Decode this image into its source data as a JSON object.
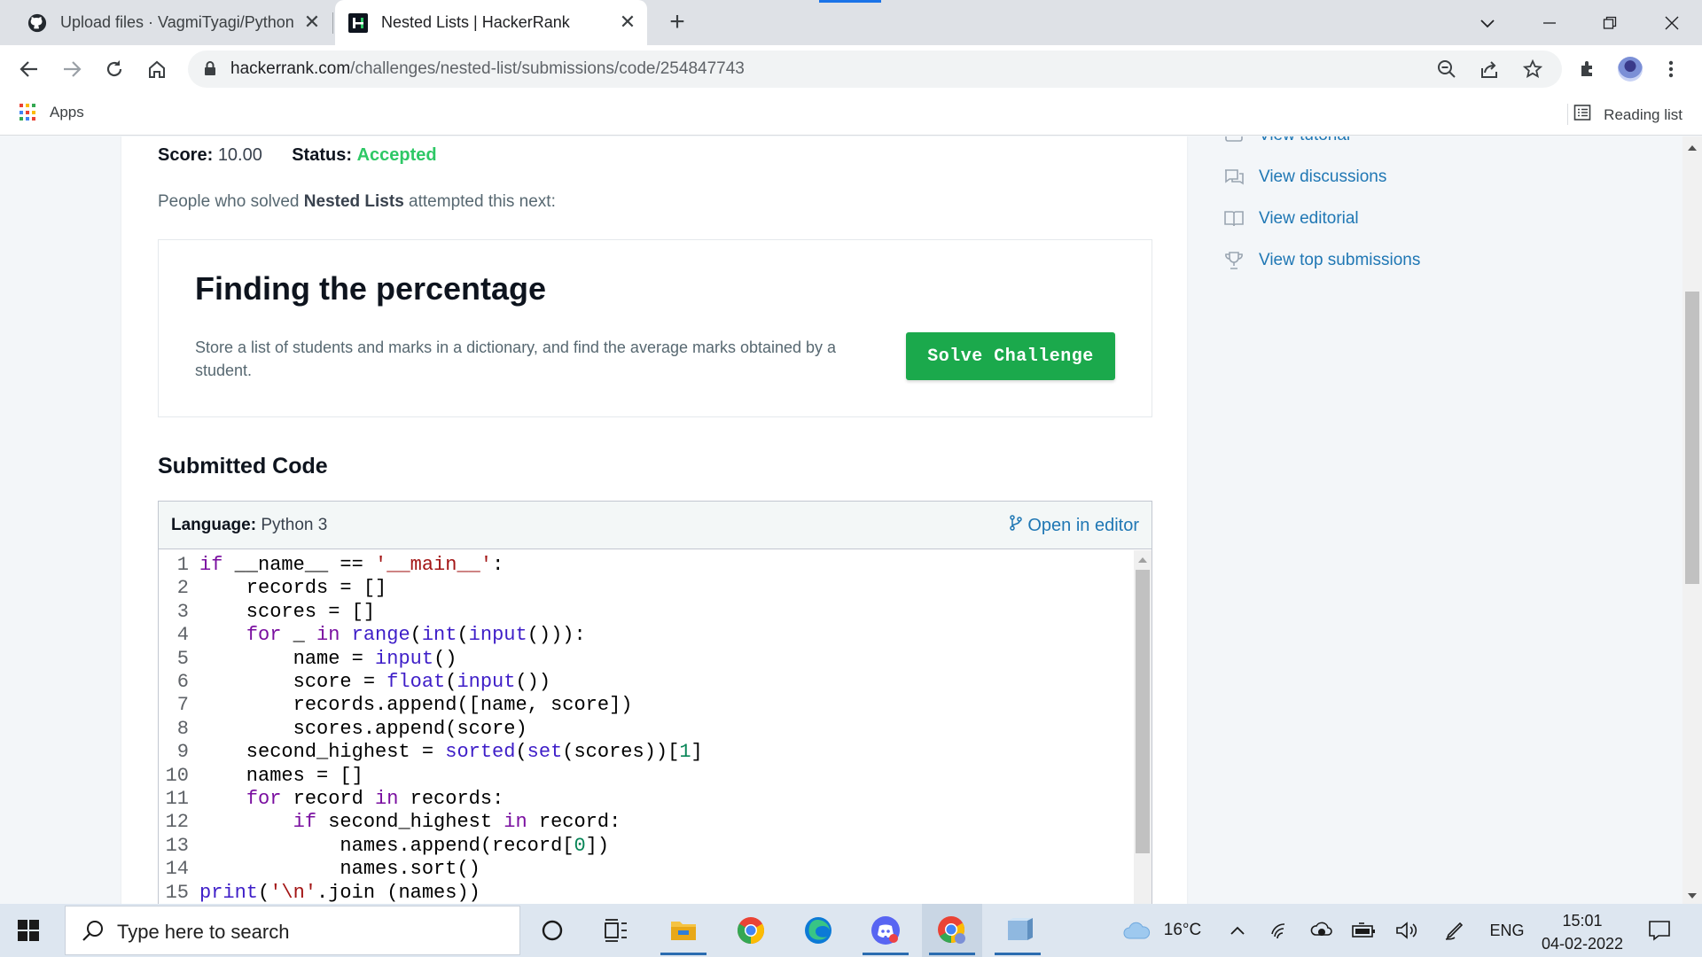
{
  "browser": {
    "tabs": [
      {
        "title": "Upload files · VagmiTyagi/Python",
        "active": false,
        "icon": "github-icon"
      },
      {
        "title": "Nested Lists | HackerRank",
        "active": true,
        "icon": "hackerrank-icon"
      }
    ],
    "new_tab": "+",
    "url_host": "hackerrank.com",
    "url_path": "/challenges/nested-list/submissions/code/254847743",
    "bookmarks": {
      "apps_label": "Apps",
      "reading_list_label": "Reading list"
    }
  },
  "submission": {
    "score_label": "Score:",
    "score_value": "10.00",
    "status_label": "Status:",
    "status_value": "Accepted",
    "status_color": "#2ec866"
  },
  "next_challenge": {
    "intro_before": "People who solved ",
    "intro_bold": "Nested Lists",
    "intro_after": " attempted this next:",
    "title": "Finding the percentage",
    "description": "Store a list of students and marks in a dictionary, and find the average marks obtained by a student.",
    "button_label": "Solve Challenge",
    "button_color": "#1ba94c"
  },
  "submitted_code": {
    "heading": "Submitted Code",
    "language_label": "Language:",
    "language_value": "Python 3",
    "open_in_editor": "Open in editor",
    "line_numbers": [
      "1",
      "2",
      "3",
      "4",
      "5",
      "6",
      "7",
      "8",
      "9",
      "10",
      "11",
      "12",
      "13",
      "14",
      "15"
    ],
    "lines": [
      "if __name__ == '__main__':",
      "    records = []",
      "    scores = []",
      "    for _ in range(int(input())):",
      "        name = input()",
      "        score = float(input())",
      "        records.append([name, score])",
      "        scores.append(score)",
      "    second_highest = sorted(set(scores))[1]",
      "    names = []",
      "    for record in records:",
      "        if second_highest in record:",
      "            names.append(record[0])",
      "            names.sort()",
      "print('\\n'.join (names))"
    ]
  },
  "sidebar": {
    "links": [
      {
        "label": "View tutorial",
        "icon": "tutorial-icon"
      },
      {
        "label": "View discussions",
        "icon": "discussions-icon"
      },
      {
        "label": "View editorial",
        "icon": "editorial-icon"
      },
      {
        "label": "View top submissions",
        "icon": "trophy-icon"
      }
    ]
  },
  "taskbar": {
    "search_placeholder": "Type here to search",
    "weather": "16°C",
    "language": "ENG",
    "time": "15:01",
    "date": "04-02-2022"
  }
}
